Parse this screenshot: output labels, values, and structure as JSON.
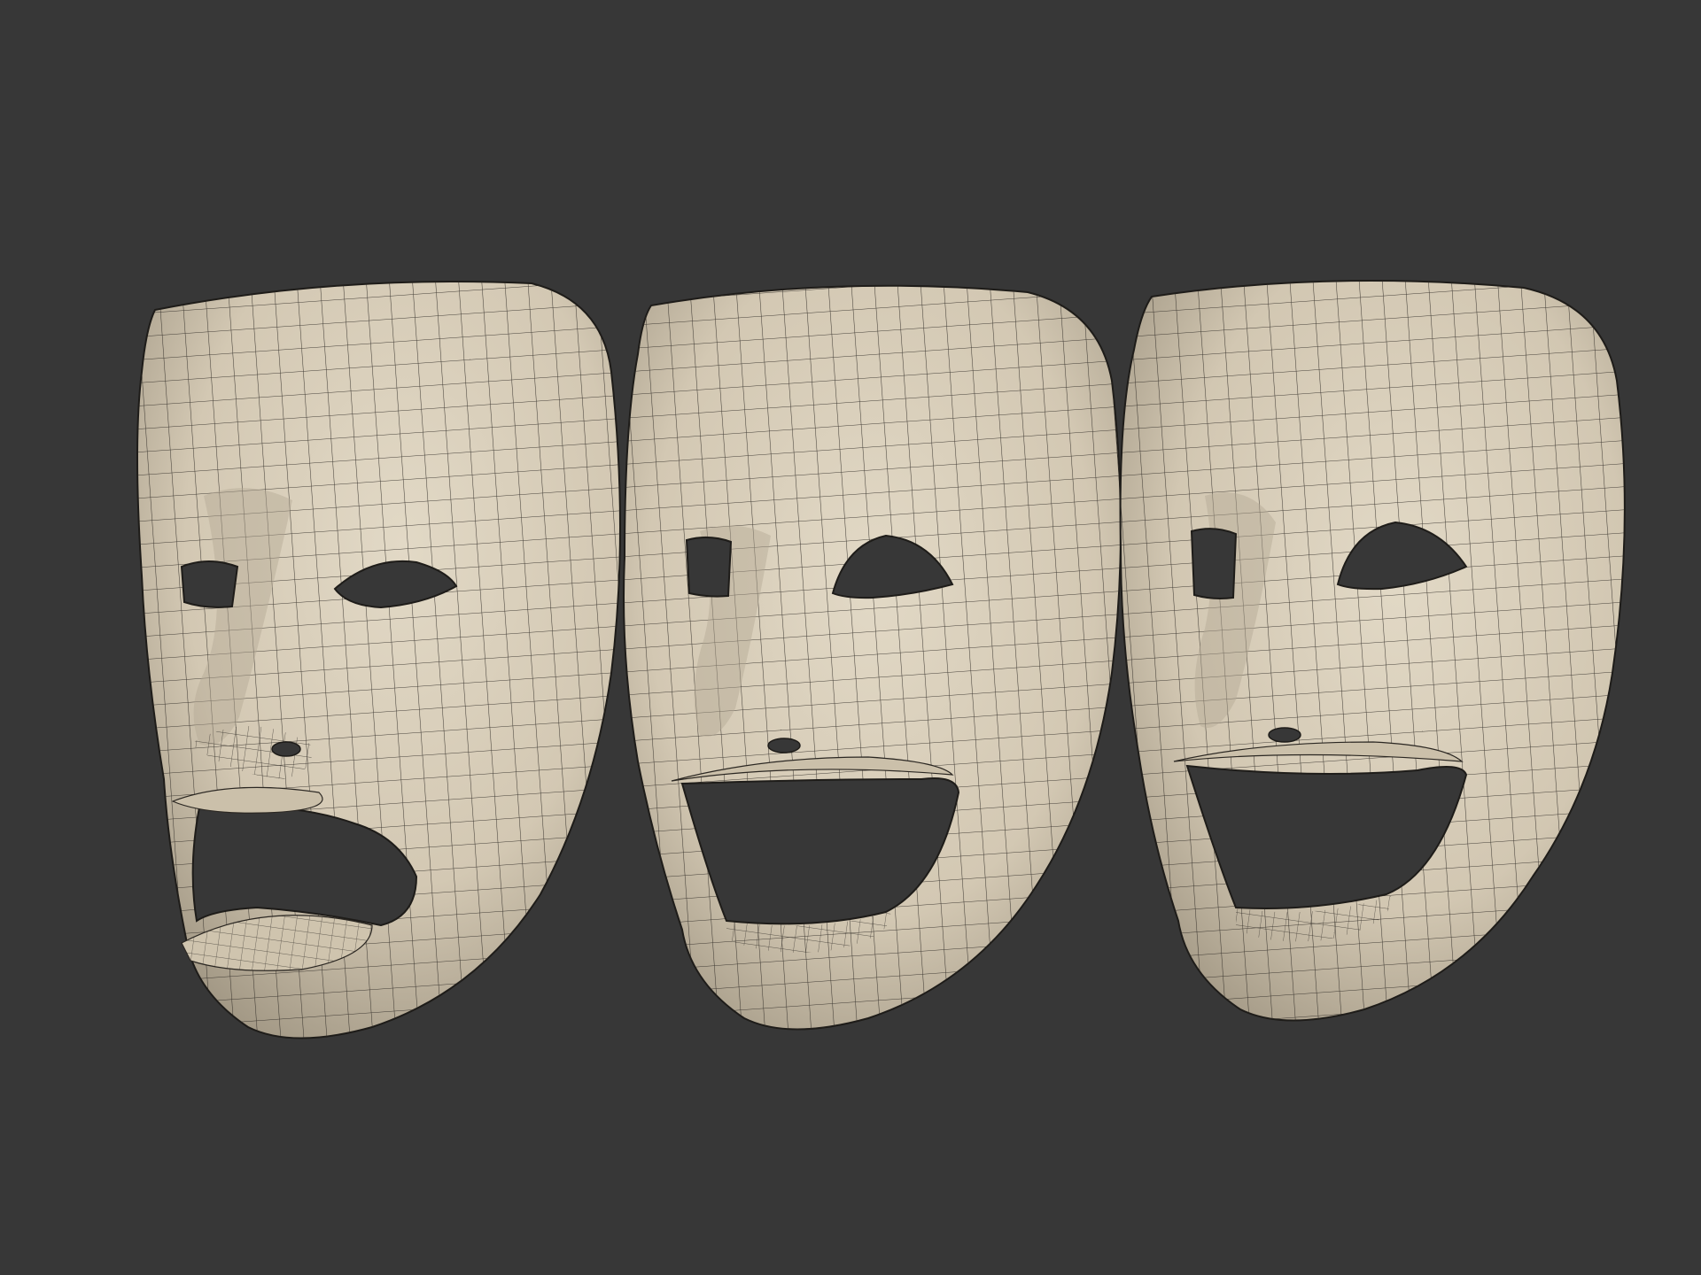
{
  "scene": {
    "background_color": "#373737",
    "mesh_fill_color": "#d6ccb8",
    "mesh_shadow_color": "#8f8676",
    "wireframe_color": "#2b2722",
    "hole_color": "#373737",
    "models": [
      {
        "expression": "tragedy",
        "wireframe": true
      },
      {
        "expression": "comedy",
        "wireframe": true
      },
      {
        "expression": "comedy",
        "wireframe": true
      }
    ]
  }
}
